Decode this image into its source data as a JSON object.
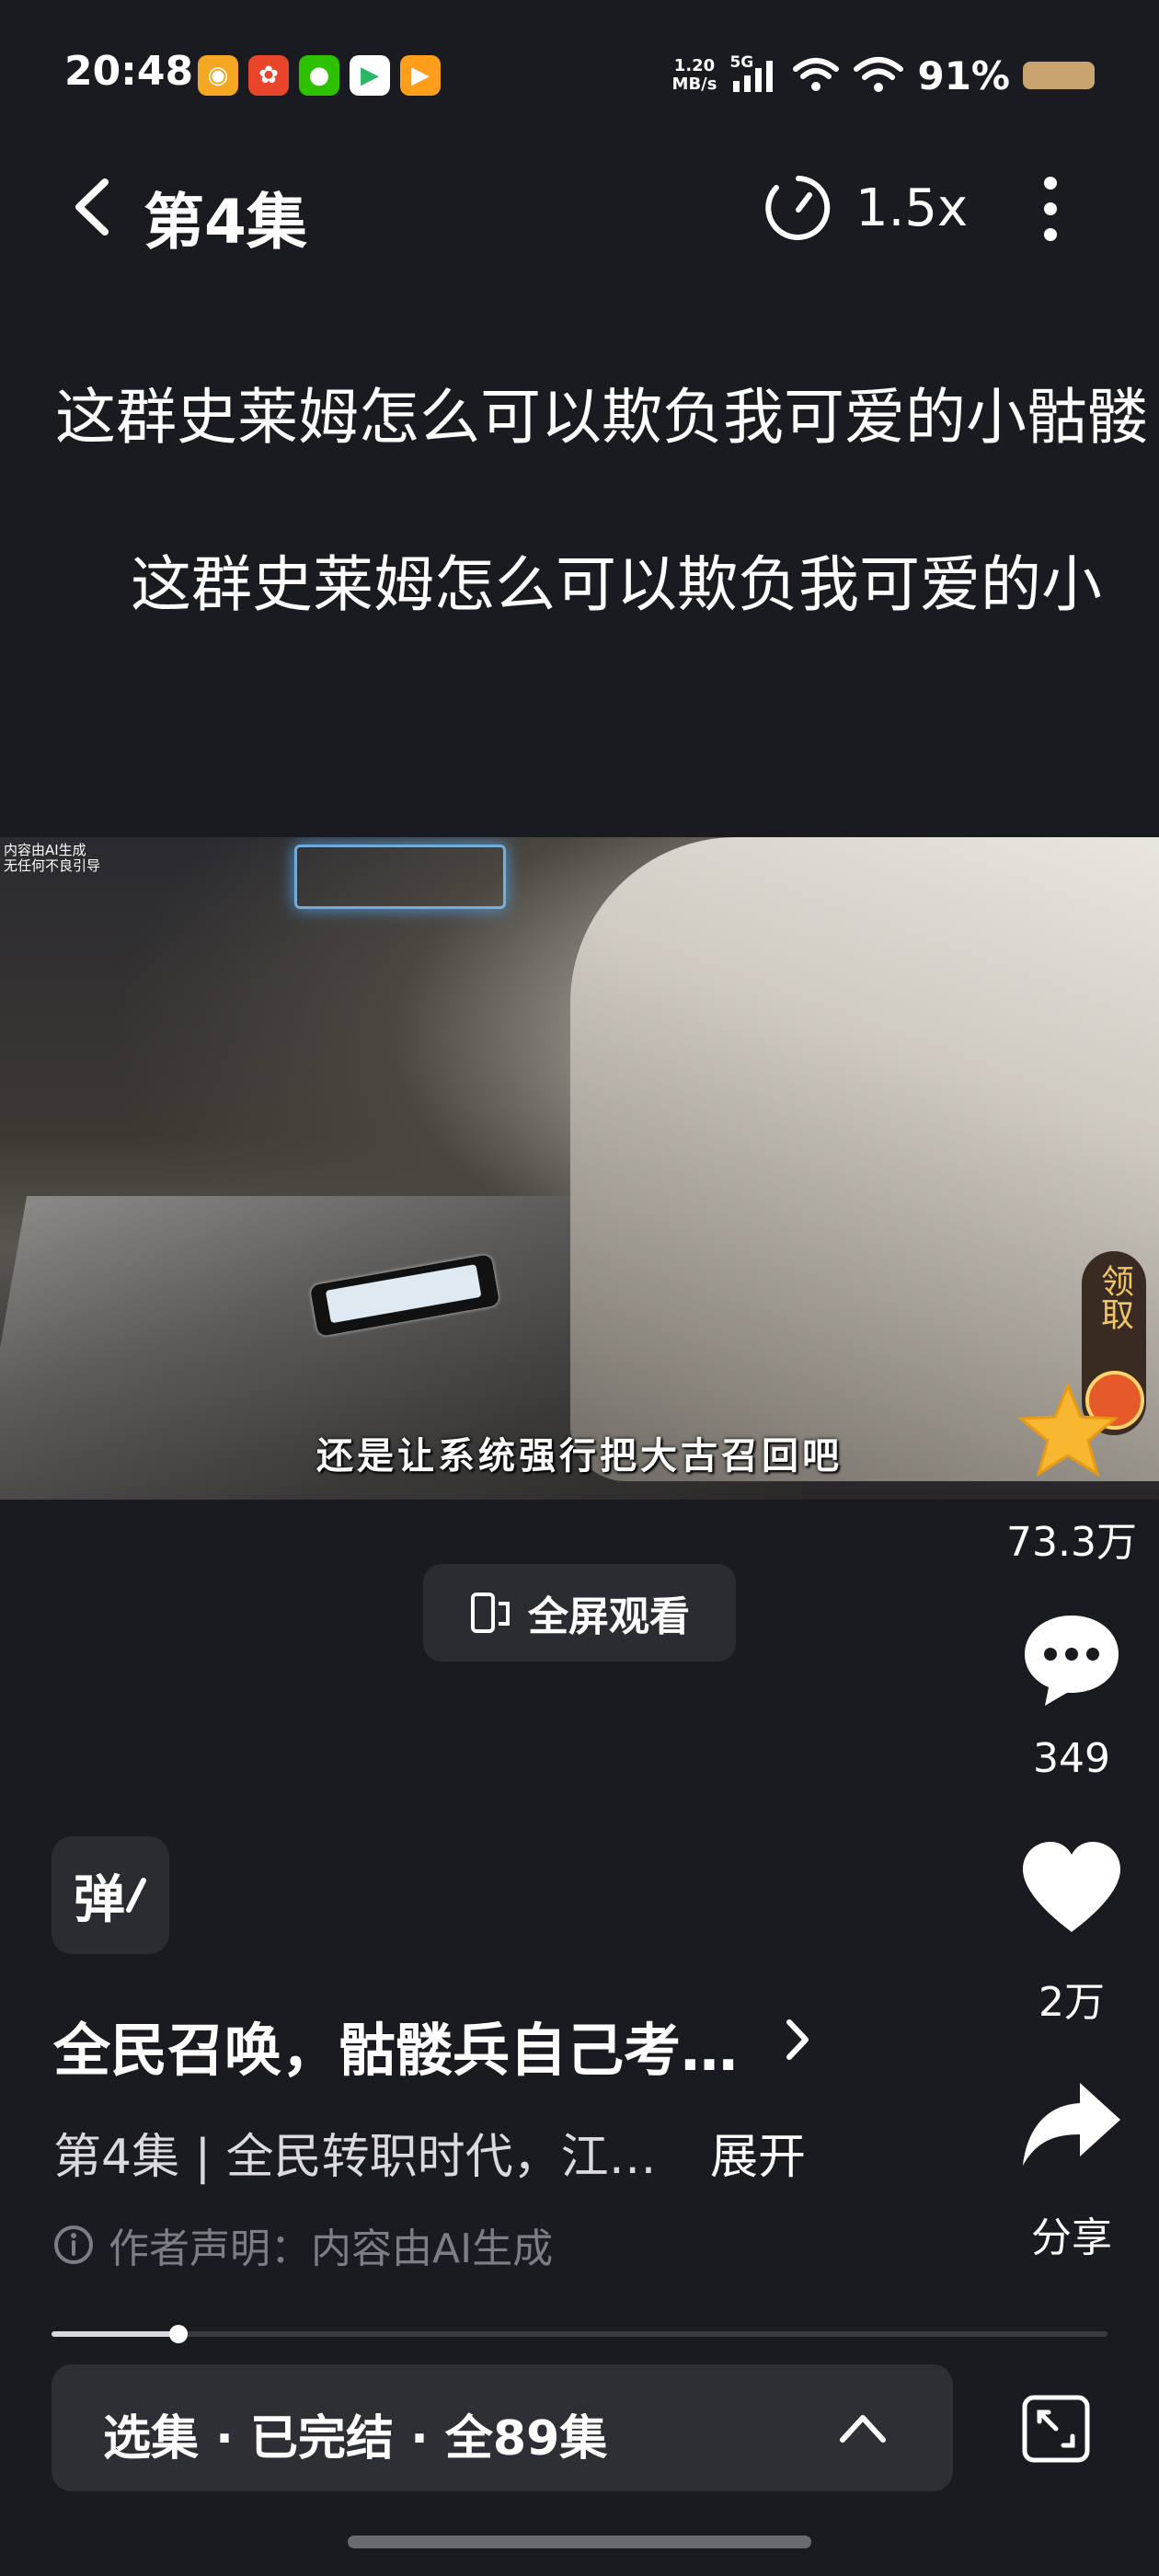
{
  "status_bar": {
    "time": "20:48",
    "net_speed_value": "1.20",
    "net_speed_unit": "MB/s",
    "network_type": "5G",
    "battery": "91%",
    "app_icons": [
      "weibo-icon",
      "film-app-icon",
      "wechat-icon",
      "video-play-icon",
      "video-app-icon"
    ]
  },
  "header": {
    "title": "第4集",
    "speed": "1.5x"
  },
  "subtitles": {
    "line_1": "这群史莱姆怎么可以欺负我可爱的小骷髅",
    "line_2": "这群史莱姆怎么可以欺负我可爱的小"
  },
  "video": {
    "ai_mark_1": "内容由AI生成",
    "ai_mark_2": "无任何不良引导",
    "caption": "还是让系统强行把大古召回吧"
  },
  "reward": {
    "label": "领取"
  },
  "actions": {
    "star_count": "73.3万",
    "comment_count": "349",
    "like_count": "2万",
    "share_label": "分享"
  },
  "fullscreen": {
    "label": "全屏观看"
  },
  "danmaku": {
    "label": "弹"
  },
  "info": {
    "drama_title": "全民召唤，骷髅兵自己考…",
    "episode_desc": "第4集 | 全民转职时代，江…",
    "expand": "展开",
    "statement": "作者声明：内容由AI生成"
  },
  "progress": {
    "fraction": 0.12
  },
  "episode_bar": {
    "label": "选集 · 已完结 · 全89集"
  },
  "colors": {
    "background": "#1a1b20",
    "panel": "#2e2f35",
    "reward_gold": "#f1c56a",
    "battery": "#c9a46e"
  }
}
